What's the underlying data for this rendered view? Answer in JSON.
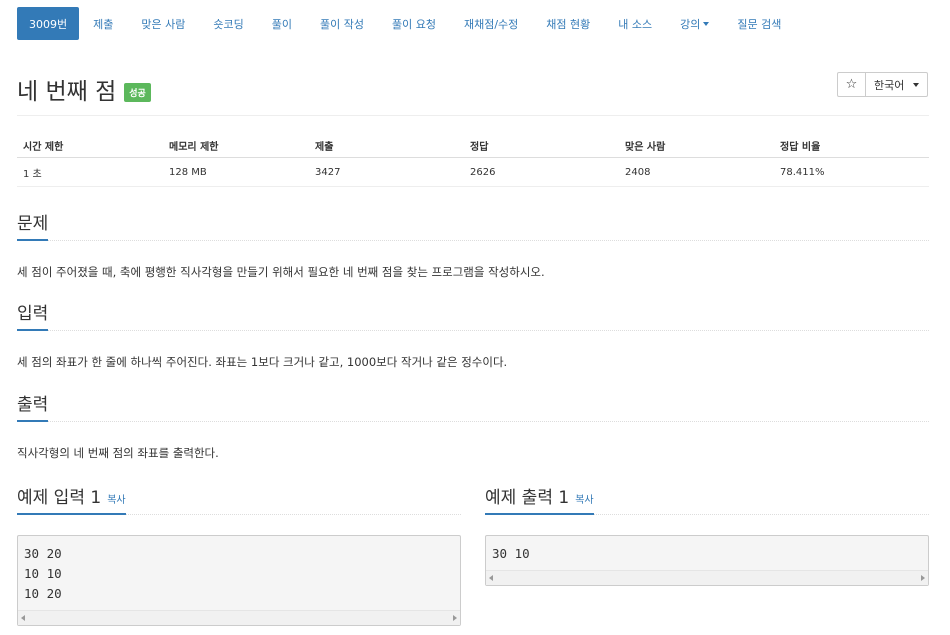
{
  "nav": {
    "items": [
      "3009번",
      "제출",
      "맞은 사람",
      "숏코딩",
      "풀이",
      "풀이 작성",
      "풀이 요청",
      "재채점/수정",
      "채점 현황",
      "내 소스",
      "강의",
      "질문 검색"
    ]
  },
  "problem": {
    "title": "네 번째 점",
    "badge": "성공",
    "star": "☆",
    "language": "한국어"
  },
  "stats": {
    "headers": [
      "시간 제한",
      "메모리 제한",
      "제출",
      "정답",
      "맞은 사람",
      "정답 비율"
    ],
    "values": [
      "1 초",
      "128 MB",
      "3427",
      "2626",
      "2408",
      "78.411%"
    ]
  },
  "sections": {
    "problem_heading": "문제",
    "problem_text": "세 점이 주어졌을 때, 축에 평행한 직사각형을 만들기 위해서 필요한 네 번째 점을 찾는 프로그램을 작성하시오.",
    "input_heading": "입력",
    "input_text": "세 점의 좌표가 한 줄에 하나씩 주어진다. 좌표는 1보다 크거나 같고, 1000보다 작거나 같은 정수이다.",
    "output_heading": "출력",
    "output_text": "직사각형의 네 번째 점의 좌표를 출력한다."
  },
  "examples": {
    "input_heading": "예제 입력 1",
    "output_heading": "예제 출력 1",
    "copy_label": "복사",
    "input_text": "30 20\n10 10\n10 20",
    "output_text": "30 10"
  },
  "colors": {
    "accent": "#337ab7",
    "success": "#5cb85c"
  }
}
